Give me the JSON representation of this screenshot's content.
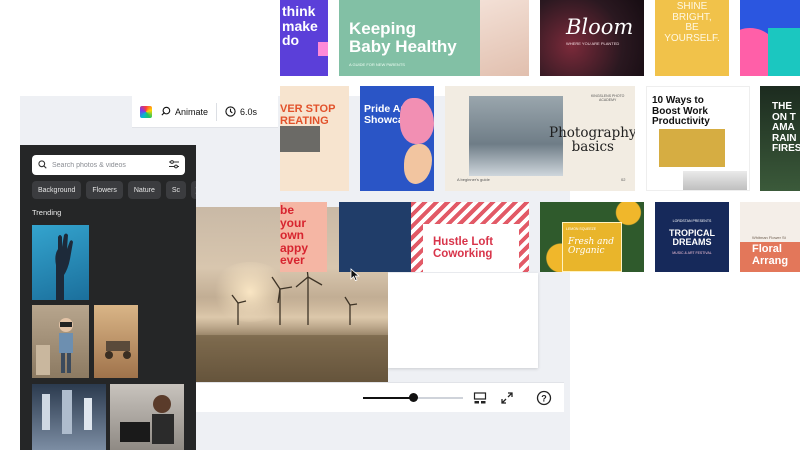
{
  "toolbar": {
    "animate_label": "Animate",
    "duration_label": "6.0s"
  },
  "sidebar": {
    "search_placeholder": "Search photos & videos",
    "chips": [
      "Background",
      "Flowers",
      "Nature",
      "Sc"
    ],
    "section_title": "Trending"
  },
  "zoom": {
    "level": 0.5
  },
  "templates": {
    "think": "think\nmake\ndo",
    "keeping_title": "Keeping\nBaby Healthy",
    "keeping_sub": "A GUIDE FOR NEW PARENTS",
    "bloom_title": "Bloom",
    "bloom_sub": "WHERE YOU ARE PLANTED",
    "shine": "SHINE\nBRIGHT,\nBE\nYOURSELF.",
    "never_stop": "VER STOP\nREATING",
    "pride_title": "Pride Art\nShowcase",
    "photo_title": "Photography\nbasics",
    "photo_academy": "KINGSLENS PHOTO\nACADEMY",
    "photo_guide": "A beginner's guide",
    "photo_num": "02",
    "boost": "10 Ways to\nBoost Work\nProductivity",
    "rain": "THE\nON T\nAMA\nRAIN\nFIRES",
    "be_your": "be\nyour\nown\nappy\never",
    "hustle": "Hustle Loft\nCoworking",
    "fresh_top": "LEMON SQUEEZE",
    "fresh": "Fresh and\nOrganic",
    "tropical_top": "LORDSTAN PRESENTS",
    "tropical": "TROPICAL\nDREAMS",
    "tropical_sub": "MUSIC & ART FESTIVAL",
    "floral_top": "Whitman Flower St",
    "floral": "Floral\nArrang"
  }
}
